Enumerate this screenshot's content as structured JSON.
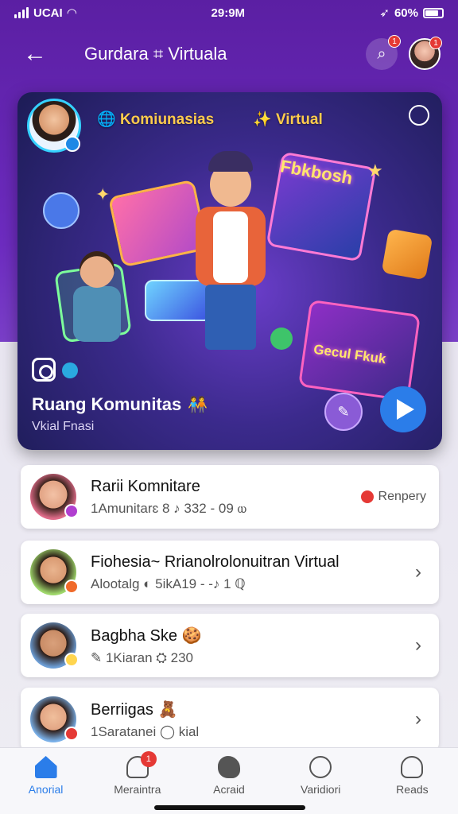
{
  "status_bar": {
    "carrier": "UCAI",
    "time": "29:9M",
    "battery": "60%"
  },
  "header": {
    "title": "Gurdara ⌗ Virtuala",
    "notification_count": "1",
    "avatar_badge": "1"
  },
  "hero": {
    "tag_left": "Komiunasias",
    "tag_right": "Virtual",
    "card_text_1": "Fbkbosh",
    "card_text_2": "Gecul Fkuk",
    "title": "Ruang Komunitas",
    "title_emoji": "🧑‍🤝‍🧑",
    "subtitle": "Vkial Fnasi"
  },
  "list": [
    {
      "name": "Rarii Komnitare",
      "meta": "1Amunitarɛ  8 ♪   332 - 09   ⲱ",
      "status": "Renpery",
      "avatar_color": "#e06c8a",
      "mini_color": "#b13fd0"
    },
    {
      "name": "Fiohesia~ Rrianolrolonuitran Virtual",
      "meta": "Alootalg ◐ 5ikA19 - -♪  1  ℚ",
      "avatar_color": "#9fd86b",
      "mini_color": "#f06a2a"
    },
    {
      "name": "Bagbha Ske 🍪",
      "meta": "✎ 1Kiaran   ⛭ 230",
      "avatar_color": "#6c9ed6",
      "mini_color": "#ffd54f"
    },
    {
      "name": "Berriigas 🧸",
      "meta": "1Saratanei   ◯ kial",
      "avatar_color": "#7ab0e8",
      "mini_color": "#e53935"
    }
  ],
  "bottom_nav": [
    {
      "label": "Anorial",
      "icon": "home-icon",
      "active": true
    },
    {
      "label": "Meraintra",
      "icon": "people-icon",
      "badge": "1"
    },
    {
      "label": "Acraid",
      "icon": "cloud-icon"
    },
    {
      "label": "Varidiori",
      "icon": "globe-icon"
    },
    {
      "label": "Reads",
      "icon": "user-icon"
    }
  ],
  "colors": {
    "accent": "#2b7de9",
    "header_purple": "#5b1fa3",
    "badge_red": "#e53935"
  }
}
